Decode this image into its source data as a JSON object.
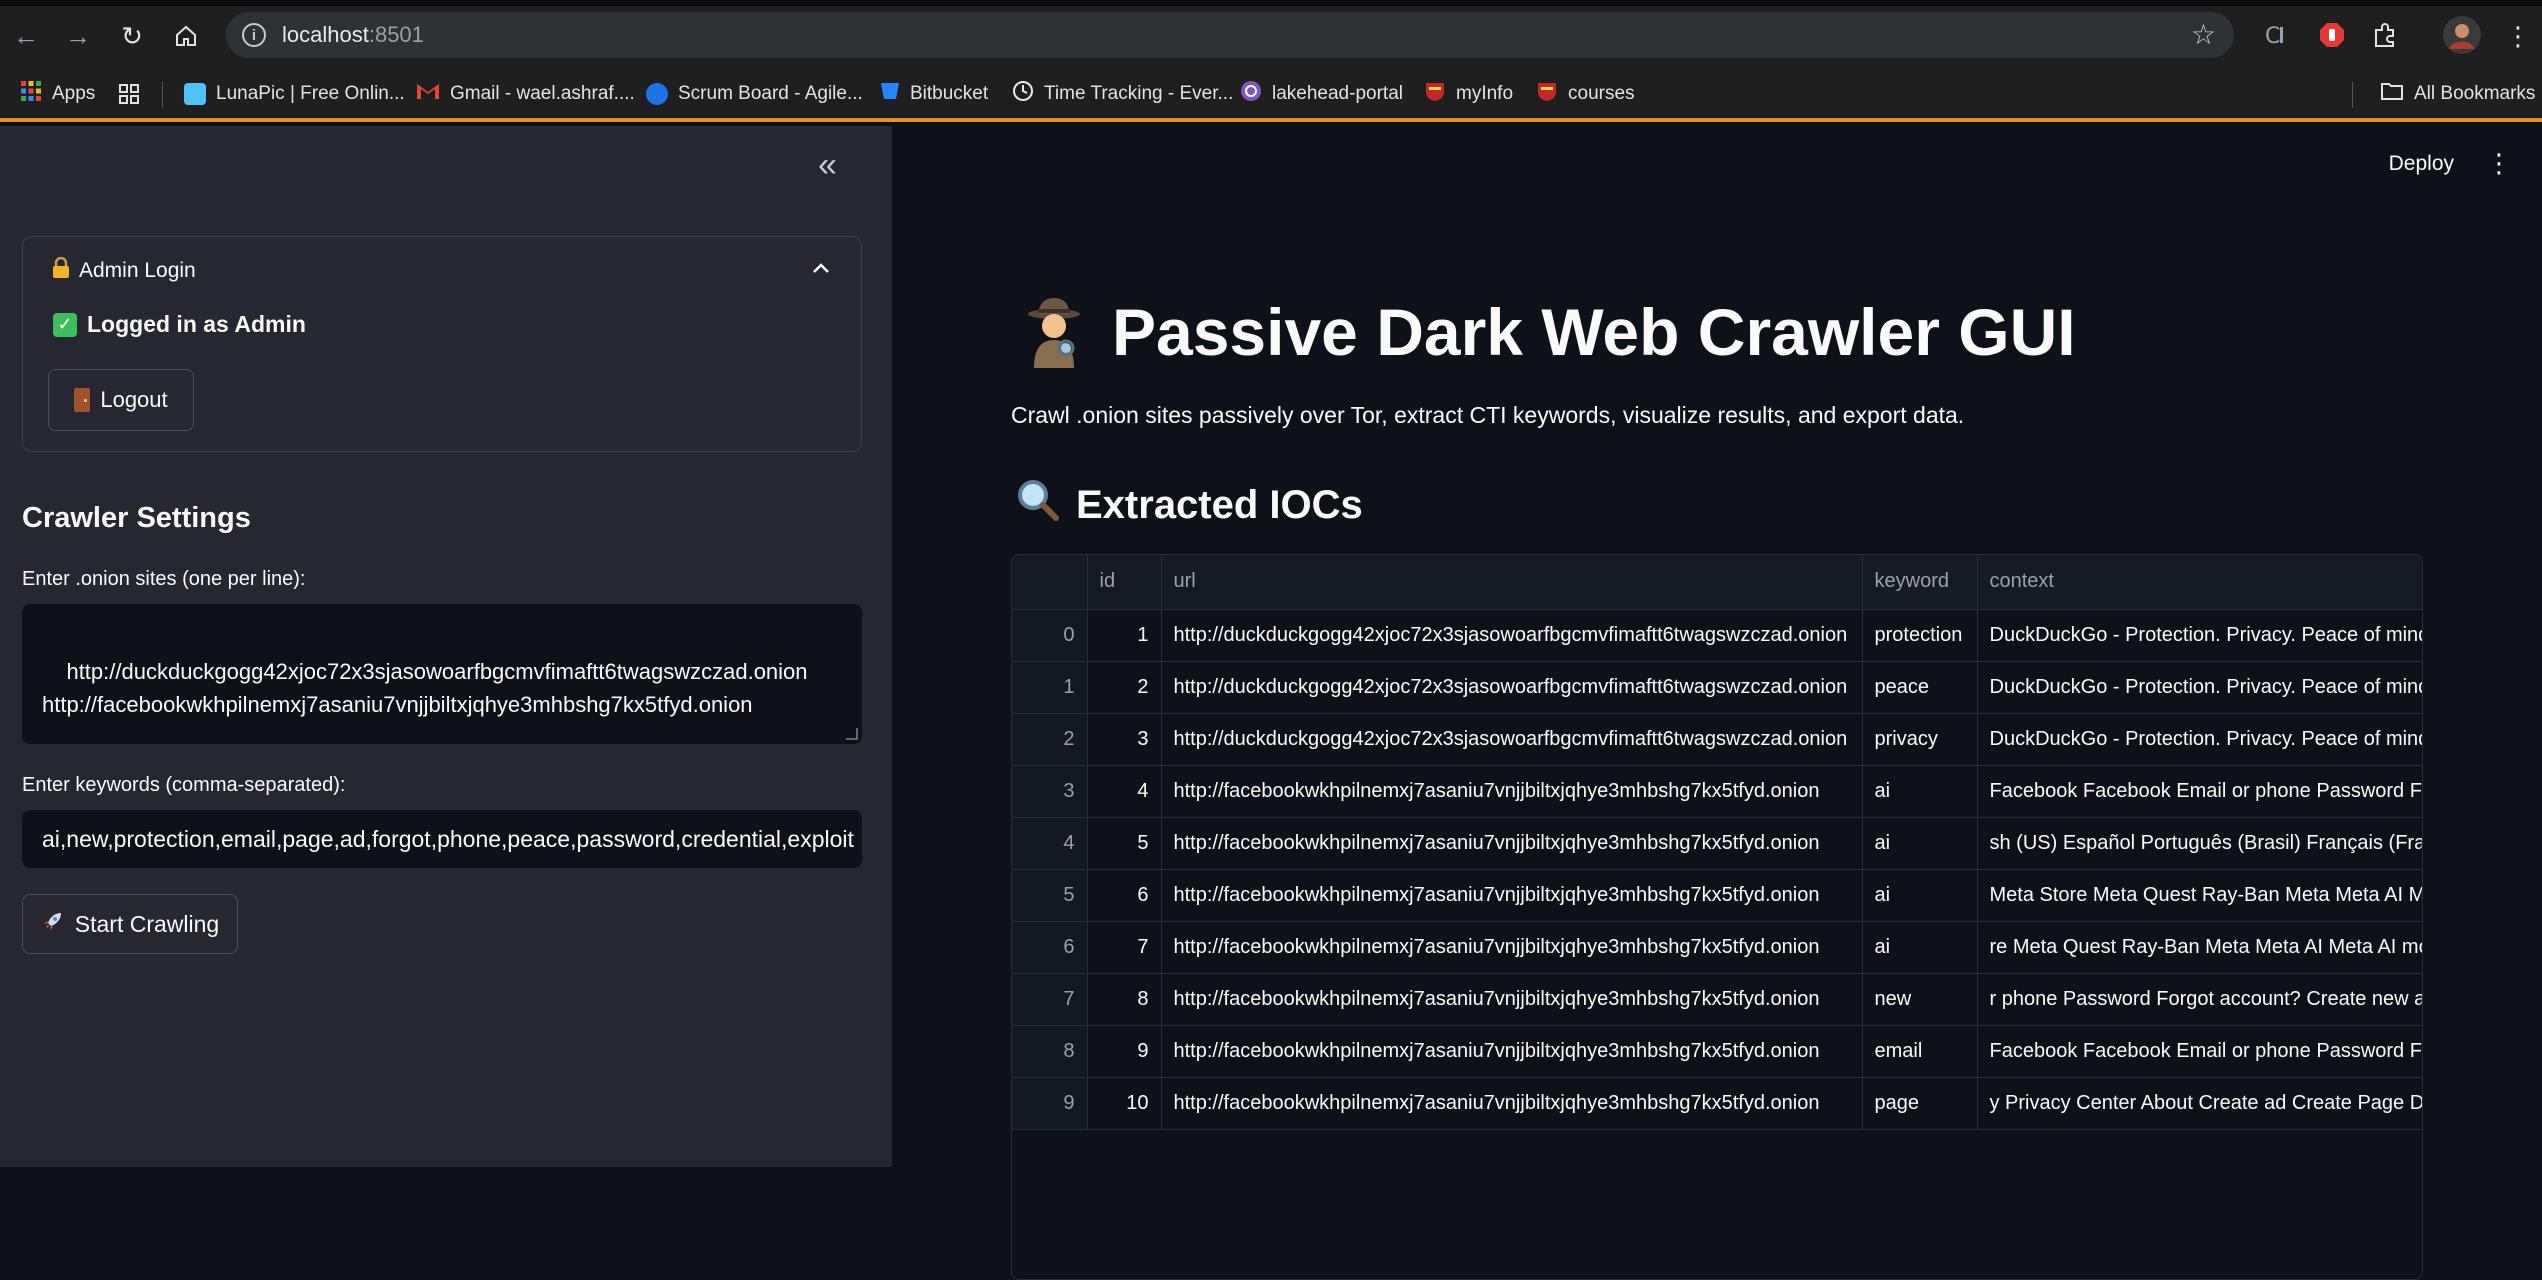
{
  "browser": {
    "url_host": "localhost",
    "url_port": ":8501",
    "bookmarks": [
      {
        "label": "Apps",
        "color": "#f4b400"
      },
      {
        "label": "LunaPic | Free Onlin...",
        "color": "#4fc3f7"
      },
      {
        "label": "Gmail - wael.ashraf....",
        "color": "#ea4335"
      },
      {
        "label": "Scrum Board - Agile...",
        "color": "#1a73e8"
      },
      {
        "label": "Bitbucket",
        "color": "#2684ff"
      },
      {
        "label": "Time Tracking - Ever...",
        "color": "#e8eaed"
      },
      {
        "label": "lakehead-portal",
        "color": "#7e57c2"
      },
      {
        "label": "myInfo",
        "color": "#c62828"
      },
      {
        "label": "courses",
        "color": "#c62828"
      }
    ],
    "all_bookmarks": "All Bookmarks"
  },
  "sidebar": {
    "expander_title": "Admin Login",
    "status": "Logged in as Admin",
    "logout_label": "Logout",
    "section_title": "Crawler Settings",
    "sites_label": "Enter .onion sites (one per line):",
    "sites_value": "http://duckduckgogg42xjoc72x3sjasowoarfbgcmvfimaftt6twagswzczad.onion\nhttp://facebookwkhpilnemxj7asaniu7vnjjbiltxjqhye3mhbshg7kx5tfyd.onion",
    "keywords_label": "Enter keywords (comma-separated):",
    "keywords_value": "ai,new,protection,email,page,ad,forgot,phone,peace,password,credential,exploit",
    "start_label": "Start Crawling"
  },
  "main": {
    "deploy_label": "Deploy",
    "title": "Passive Dark Web Crawler GUI",
    "subtitle": "Crawl .onion sites passively over Tor, extract CTI keywords, visualize results, and export data.",
    "section_title": "Extracted IOCs",
    "table": {
      "columns": [
        "",
        "id",
        "url",
        "keyword",
        "context"
      ],
      "rows": [
        [
          "0",
          "1",
          "http://duckduckgogg42xjoc72x3sjasowoarfbgcmvfimaftt6twagswzczad.onion",
          "protection",
          "DuckDuckGo - Protection. Privacy. Peace of mind"
        ],
        [
          "1",
          "2",
          "http://duckduckgogg42xjoc72x3sjasowoarfbgcmvfimaftt6twagswzczad.onion",
          "peace",
          "DuckDuckGo - Protection. Privacy. Peace of mind"
        ],
        [
          "2",
          "3",
          "http://duckduckgogg42xjoc72x3sjasowoarfbgcmvfimaftt6twagswzczad.onion",
          "privacy",
          "DuckDuckGo - Protection. Privacy. Peace of mind"
        ],
        [
          "3",
          "4",
          "http://facebookwkhpilnemxj7asaniu7vnjjbiltxjqhye3mhbshg7kx5tfyd.onion",
          "ai",
          "Facebook Facebook Email or phone Password Fo"
        ],
        [
          "4",
          "5",
          "http://facebookwkhpilnemxj7asaniu7vnjjbiltxjqhye3mhbshg7kx5tfyd.onion",
          "ai",
          "sh (US) Español Português (Brasil) Français (Fran"
        ],
        [
          "5",
          "6",
          "http://facebookwkhpilnemxj7asaniu7vnjjbiltxjqhye3mhbshg7kx5tfyd.onion",
          "ai",
          "Meta Store Meta Quest Ray-Ban Meta Meta AI Me"
        ],
        [
          "6",
          "7",
          "http://facebookwkhpilnemxj7asaniu7vnjjbiltxjqhye3mhbshg7kx5tfyd.onion",
          "ai",
          "re Meta Quest Ray-Ban Meta Meta AI Meta AI mor"
        ],
        [
          "7",
          "8",
          "http://facebookwkhpilnemxj7asaniu7vnjjbiltxjqhye3mhbshg7kx5tfyd.onion",
          "new",
          "r phone Password Forgot account? Create new ac"
        ],
        [
          "8",
          "9",
          "http://facebookwkhpilnemxj7asaniu7vnjjbiltxjqhye3mhbshg7kx5tfyd.onion",
          "email",
          "Facebook Facebook Email or phone Password Fo"
        ],
        [
          "9",
          "10",
          "http://facebookwkhpilnemxj7asaniu7vnjjbiltxjqhye3mhbshg7kx5tfyd.onion",
          "page",
          "y Privacy Center About Create ad Create Page De"
        ]
      ]
    }
  }
}
